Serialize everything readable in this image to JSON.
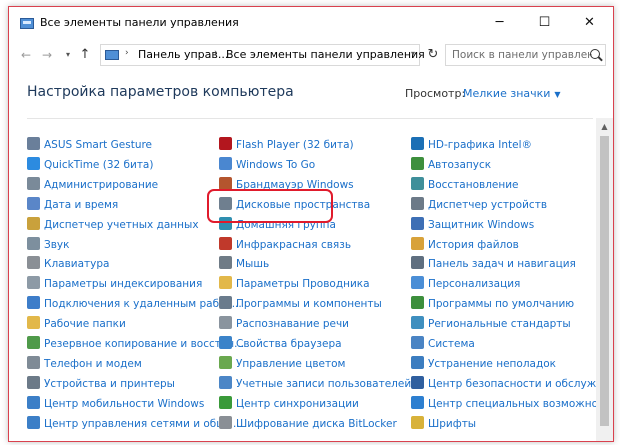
{
  "window": {
    "title": "Все элементы панели управления",
    "minimize": "─",
    "maximize": "☐",
    "close": "✕"
  },
  "nav": {
    "back": "←",
    "forward": "→",
    "recent": "▾",
    "up": "↑",
    "refresh": "↻"
  },
  "address": {
    "sep1": "›",
    "crumb1": "Панель управ...",
    "sep2": "›",
    "crumb2": "Все элементы панели управления",
    "dropdown": "▾"
  },
  "search": {
    "placeholder": "Поиск в панели управления"
  },
  "header": {
    "title": "Настройка параметров компьютера",
    "view_label": "Просмотр:",
    "view_value": "Мелкие значки",
    "view_caret": "▼"
  },
  "scroll": {
    "up": "▲"
  },
  "columns": [
    [
      {
        "label": "ASUS Smart Gesture",
        "icon": "touchpad-icon",
        "color": "#6a7f9a"
      },
      {
        "label": "QuickTime (32 бита)",
        "icon": "quicktime-icon",
        "color": "#2c8be0"
      },
      {
        "label": "Администрирование",
        "icon": "admin-tools-icon",
        "color": "#7a8a99"
      },
      {
        "label": "Дата и время",
        "icon": "clock-icon",
        "color": "#5a86c8"
      },
      {
        "label": "Диспетчер учетных данных",
        "icon": "credential-icon",
        "color": "#c9a13c"
      },
      {
        "label": "Звук",
        "icon": "speaker-icon",
        "color": "#7d8f9e"
      },
      {
        "label": "Клавиатура",
        "icon": "keyboard-icon",
        "color": "#8a8f95"
      },
      {
        "label": "Параметры индексирования",
        "icon": "indexing-icon",
        "color": "#8d9aa6"
      },
      {
        "label": "Подключения к удаленным рабоч...",
        "icon": "remote-desktop-icon",
        "color": "#3d7dc9"
      },
      {
        "label": "Рабочие папки",
        "icon": "folder-icon",
        "color": "#e2b84a"
      },
      {
        "label": "Резервное копирование и восстан...",
        "icon": "backup-icon",
        "color": "#4f9a4a"
      },
      {
        "label": "Телефон и модем",
        "icon": "phone-icon",
        "color": "#7f8b96"
      },
      {
        "label": "Устройства и принтеры",
        "icon": "printer-icon",
        "color": "#6c7a88"
      },
      {
        "label": "Центр мобильности Windows",
        "icon": "mobility-icon",
        "color": "#3c7fc7"
      },
      {
        "label": "Центр управления сетями и общи...",
        "icon": "network-icon",
        "color": "#3c7fc7"
      }
    ],
    [
      {
        "label": "Flash Player (32 бита)",
        "icon": "flash-icon",
        "color": "#b3161e"
      },
      {
        "label": "Windows To Go",
        "icon": "windows-to-go-icon",
        "color": "#4a87d0"
      },
      {
        "label": "Брандмауэр Windows",
        "icon": "firewall-icon",
        "color": "#b4552e"
      },
      {
        "label": "Дисковые пространства",
        "icon": "storage-icon",
        "color": "#6f7f8f"
      },
      {
        "label": "Домашняя группа",
        "icon": "homegroup-icon",
        "color": "#2f8fb0"
      },
      {
        "label": "Инфракрасная связь",
        "icon": "infrared-icon",
        "color": "#c0392b"
      },
      {
        "label": "Мышь",
        "icon": "mouse-icon",
        "color": "#6f7b86"
      },
      {
        "label": "Параметры Проводника",
        "icon": "explorer-options-icon",
        "color": "#e2b84a"
      },
      {
        "label": "Программы и компоненты",
        "icon": "programs-icon",
        "color": "#6a7b8c"
      },
      {
        "label": "Распознавание речи",
        "icon": "microphone-icon",
        "color": "#8a949e"
      },
      {
        "label": "Свойства браузера",
        "icon": "internet-options-icon",
        "color": "#3b83c9"
      },
      {
        "label": "Управление цветом",
        "icon": "color-icon",
        "color": "#6aa84f"
      },
      {
        "label": "Учетные записи пользователей",
        "icon": "users-icon",
        "color": "#4c86c6"
      },
      {
        "label": "Центр синхронизации",
        "icon": "sync-icon",
        "color": "#3a9a3a"
      },
      {
        "label": "Шифрование диска BitLocker",
        "icon": "bitlocker-icon",
        "color": "#8a8f95"
      }
    ],
    [
      {
        "label": "HD-графика Intel®",
        "icon": "intel-graphics-icon",
        "color": "#1b6fb5"
      },
      {
        "label": "Автозапуск",
        "icon": "autoplay-icon",
        "color": "#3d8f3d"
      },
      {
        "label": "Восстановление",
        "icon": "recovery-icon",
        "color": "#3f8f9a"
      },
      {
        "label": "Диспетчер устройств",
        "icon": "device-manager-icon",
        "color": "#6c7a88"
      },
      {
        "label": "Защитник Windows",
        "icon": "defender-icon",
        "color": "#3d6fb5"
      },
      {
        "label": "История файлов",
        "icon": "file-history-icon",
        "color": "#d8a23a"
      },
      {
        "label": "Панель задач и навигация",
        "icon": "taskbar-icon",
        "color": "#5f6f80"
      },
      {
        "label": "Персонализация",
        "icon": "personalization-icon",
        "color": "#4b8ed6"
      },
      {
        "label": "Программы по умолчанию",
        "icon": "default-programs-icon",
        "color": "#3d8f3d"
      },
      {
        "label": "Региональные стандарты",
        "icon": "region-icon",
        "color": "#3f8fbf"
      },
      {
        "label": "Система",
        "icon": "system-icon",
        "color": "#4a84c4"
      },
      {
        "label": "Устранение неполадок",
        "icon": "troubleshoot-icon",
        "color": "#3c7dc0"
      },
      {
        "label": "Центр безопасности и обслужива...",
        "icon": "flag-icon",
        "color": "#2f5f9f"
      },
      {
        "label": "Центр специальных возможностей",
        "icon": "accessibility-icon",
        "color": "#2d7fd0"
      },
      {
        "label": "Шрифты",
        "icon": "fonts-icon",
        "color": "#d8b23a"
      }
    ]
  ]
}
